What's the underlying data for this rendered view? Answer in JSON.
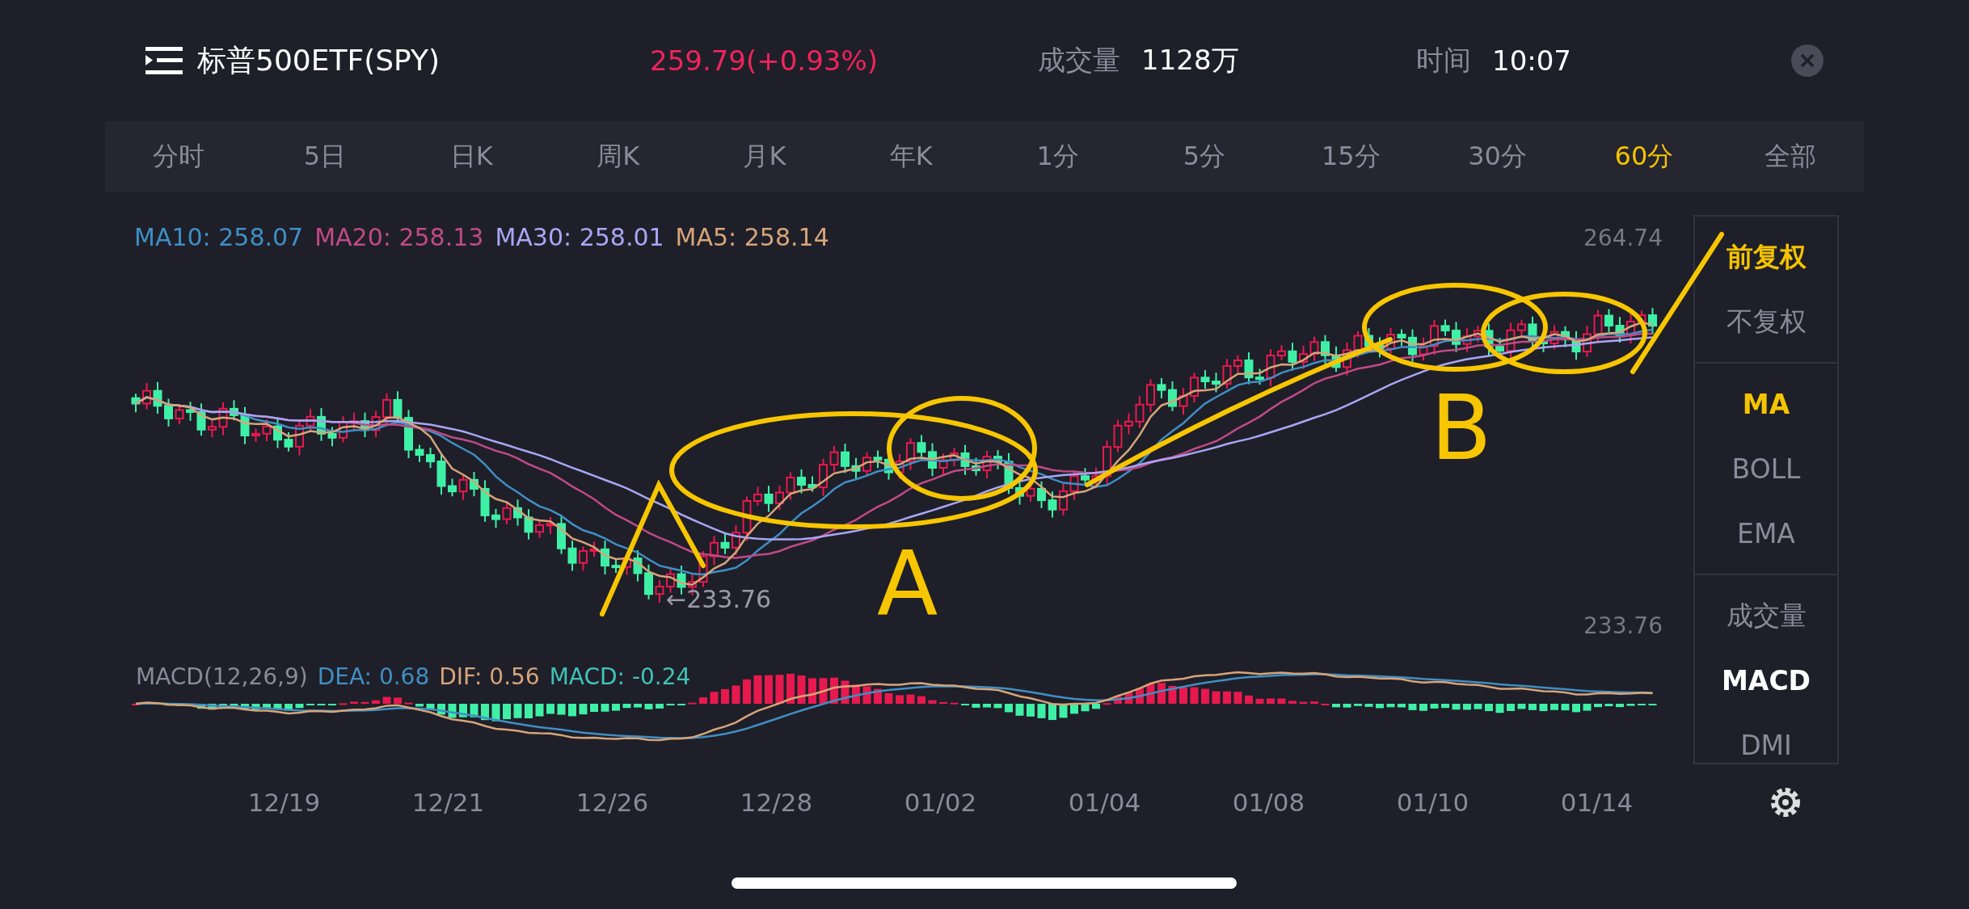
{
  "header": {
    "title": "标普500ETF(SPY)",
    "price": "259.79(+0.93%)",
    "volume_label": "成交量",
    "volume": "1128万",
    "time_label": "时间",
    "time": "10:07"
  },
  "period_tabs": [
    {
      "label": "分时",
      "selected": false
    },
    {
      "label": "5日",
      "selected": false
    },
    {
      "label": "日K",
      "selected": false
    },
    {
      "label": "周K",
      "selected": false
    },
    {
      "label": "月K",
      "selected": false
    },
    {
      "label": "年K",
      "selected": false
    },
    {
      "label": "1分",
      "selected": false
    },
    {
      "label": "5分",
      "selected": false
    },
    {
      "label": "15分",
      "selected": false
    },
    {
      "label": "30分",
      "selected": false
    },
    {
      "label": "60分",
      "selected": true
    },
    {
      "label": "全部",
      "selected": false
    }
  ],
  "chart": {
    "ma_legend": [
      {
        "text": "MA10: 258.07",
        "color": "#3f8fc4"
      },
      {
        "text": "MA20: 258.13",
        "color": "#c04a86"
      },
      {
        "text": "MA30: 258.01",
        "color": "#a9a6f5"
      },
      {
        "text": "MA5: 258.14",
        "color": "#d6a57a"
      }
    ],
    "high_label": "264.74",
    "low_marker": "←233.76",
    "right_low_label": "233.76",
    "macd_legend": [
      {
        "text": "MACD(12,26,9)",
        "color": "#8a8a9a"
      },
      {
        "text": "DEA: 0.68",
        "color": "#3f8fc4"
      },
      {
        "text": "DIF: 0.56",
        "color": "#d6a57a"
      },
      {
        "text": "MACD: -0.24",
        "color": "#3fc4b8"
      }
    ],
    "dates": [
      "12/19",
      "12/21",
      "12/26",
      "12/28",
      "01/02",
      "01/04",
      "01/08",
      "01/10",
      "01/14"
    ]
  },
  "side_panel": {
    "groups": [
      {
        "kind": "main",
        "items": [
          {
            "label": "前复权",
            "selected": true
          },
          {
            "label": "不复权",
            "selected": false
          }
        ]
      },
      {
        "kind": "main",
        "items": [
          {
            "label": "MA",
            "selected": true
          },
          {
            "label": "BOLL",
            "selected": false
          },
          {
            "label": "EMA",
            "selected": false
          }
        ]
      },
      {
        "kind": "sub",
        "items": [
          {
            "label": "成交量",
            "selected": false
          },
          {
            "label": "MACD",
            "selected": true
          },
          {
            "label": "DMI",
            "selected": false
          }
        ]
      }
    ]
  },
  "annotations": [
    {
      "text": "A"
    },
    {
      "text": "B"
    }
  ]
}
